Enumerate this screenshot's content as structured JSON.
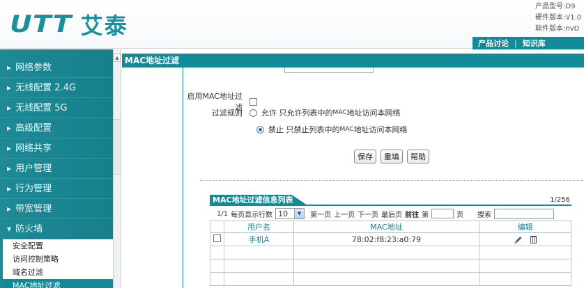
{
  "header": {
    "logo_mark": "UTT",
    "logo_cn": "艾泰",
    "device_info": [
      "产品型号:D9",
      "硬件版本:V1.0",
      "软件版本:nvD"
    ],
    "nav": [
      "产品讨论",
      "|",
      "知识库"
    ]
  },
  "sidebar": {
    "items": [
      {
        "label": "网络参数"
      },
      {
        "label": "无线配置 2.4G"
      },
      {
        "label": "无线配置 5G"
      },
      {
        "label": "高级配置"
      },
      {
        "label": "网络共享"
      },
      {
        "label": "用户管理"
      },
      {
        "label": "行为管理"
      },
      {
        "label": "带宽管理"
      },
      {
        "label": "防火墙"
      }
    ],
    "sub_items": [
      {
        "label": "安全配置"
      },
      {
        "label": "访问控制策略"
      },
      {
        "label": "域名过滤"
      },
      {
        "label": "MAC地址过滤"
      }
    ]
  },
  "page": {
    "title": "MAC地址过滤"
  },
  "form": {
    "enable_label": "启用MAC地址过滤",
    "rule_label": "过滤规则",
    "rule_allow_prefix": "允许",
    "rule_allow_text": "只允许列表中的",
    "rule_allow_mac": "MAC",
    "rule_allow_suffix": "地址访问本网络",
    "rule_deny_prefix": "禁止",
    "rule_deny_text": "只禁止列表中的",
    "rule_deny_mac": "MAC",
    "rule_deny_suffix": "地址访问本网络",
    "enabled": false,
    "selected_rule": "deny"
  },
  "buttons": {
    "save": "保存",
    "reset": "重填",
    "help": "帮助"
  },
  "list": {
    "title": "MAC地址过滤信息列表",
    "page_count": "1/256",
    "pager": {
      "page": "1/1",
      "rows_label": "每页显示行数",
      "rows_value": "10",
      "first": "第一页",
      "prev": "上一页",
      "next": "下一页",
      "last": "最后页",
      "goto": "前往",
      "nth": "第",
      "page_unit": "页",
      "search": "搜索"
    },
    "columns": [
      "用户名",
      "MAC地址",
      "编辑"
    ],
    "rows": [
      {
        "user": "手机A",
        "mac": "78:02:f8:23:a0:79"
      }
    ]
  }
}
